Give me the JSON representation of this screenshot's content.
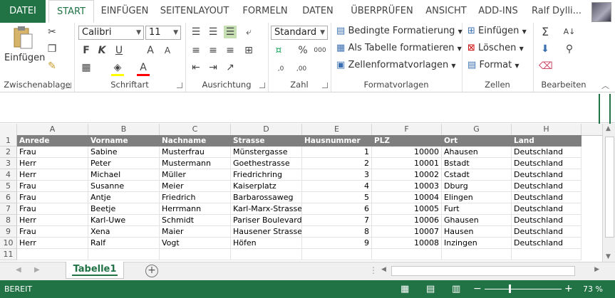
{
  "tabs": [
    "DATEI",
    "START",
    "EINFÜGEN",
    "SEITENLAYOUT",
    "FORMELN",
    "DATEN",
    "ÜBERPRÜFEN",
    "ANSICHT",
    "ADD-INS"
  ],
  "user_name": "Ralf Dylli...",
  "ribbon": {
    "clipboard": {
      "paste_label": "Einfügen",
      "group_label": "Zwischenablage"
    },
    "font": {
      "font_name": "Calibri",
      "font_size": "11",
      "group_label": "Schriftart",
      "bold": "F",
      "italic": "K",
      "underline": "U",
      "grow": "A",
      "shrink": "A",
      "font_color_glyph": "A"
    },
    "alignment": {
      "group_label": "Ausrichtung"
    },
    "number": {
      "format": "Standard",
      "percent": "%",
      "thousands": "000",
      "dec_inc": ",0",
      "dec_dec": ",00",
      "group_label": "Zahl"
    },
    "styles": {
      "conditional": "Bedingte Formatierung",
      "as_table": "Als Tabelle formatieren",
      "cell_styles": "Zellenformatvorlagen",
      "group_label": "Formatvorlagen"
    },
    "cells": {
      "insert": "Einfügen",
      "delete": "Löschen",
      "format": "Format",
      "group_label": "Zellen"
    },
    "editing": {
      "group_label": "Bearbeiten"
    }
  },
  "columns": [
    "A",
    "B",
    "C",
    "D",
    "E",
    "F",
    "G",
    "H"
  ],
  "rows": [
    "1",
    "2",
    "3",
    "4",
    "5",
    "6",
    "7",
    "8",
    "9",
    "10",
    "11"
  ],
  "table": {
    "headers": [
      "Anrede",
      "Vorname",
      "Nachname",
      "Strasse",
      "Hausnummer",
      "PLZ",
      "Ort",
      "Land"
    ],
    "data": [
      [
        "Frau",
        "Sabine",
        "Musterfrau",
        "Münstergasse",
        "1",
        "10000",
        "Ahausen",
        "Deutschland"
      ],
      [
        "Herr",
        "Peter",
        "Mustermann",
        "Goethestrasse",
        "2",
        "10001",
        "Bstadt",
        "Deutschland"
      ],
      [
        "Herr",
        "Michael",
        "Müller",
        "Friedrichring",
        "3",
        "10002",
        "Cstadt",
        "Deutschland"
      ],
      [
        "Frau",
        "Susanne",
        "Meier",
        "Kaiserplatz",
        "4",
        "10003",
        "Dburg",
        "Deutschland"
      ],
      [
        "Frau",
        "Antje",
        "Friedrich",
        "Barbarossaweg",
        "5",
        "10004",
        "Elingen",
        "Deutschland"
      ],
      [
        "Frau",
        "Beetje",
        "Herrmann",
        "Karl-Marx-Strasse",
        "6",
        "10005",
        "Furt",
        "Deutschland"
      ],
      [
        "Herr",
        "Karl-Uwe",
        "Schmidt",
        "Pariser Boulevard",
        "7",
        "10006",
        "Ghausen",
        "Deutschland"
      ],
      [
        "Frau",
        "Xena",
        "Maier",
        "Hausener Strasse",
        "8",
        "10007",
        "Hausen",
        "Deutschland"
      ],
      [
        "Herr",
        "Ralf",
        "Vogt",
        "Höfen",
        "9",
        "10008",
        "Inzingen",
        "Deutschland"
      ]
    ]
  },
  "sheet_tab": "Tabelle1",
  "status": {
    "mode": "BEREIT",
    "zoom": "73 %"
  },
  "colors": {
    "accent": "#217346",
    "table_header": "#7f7f7f"
  }
}
